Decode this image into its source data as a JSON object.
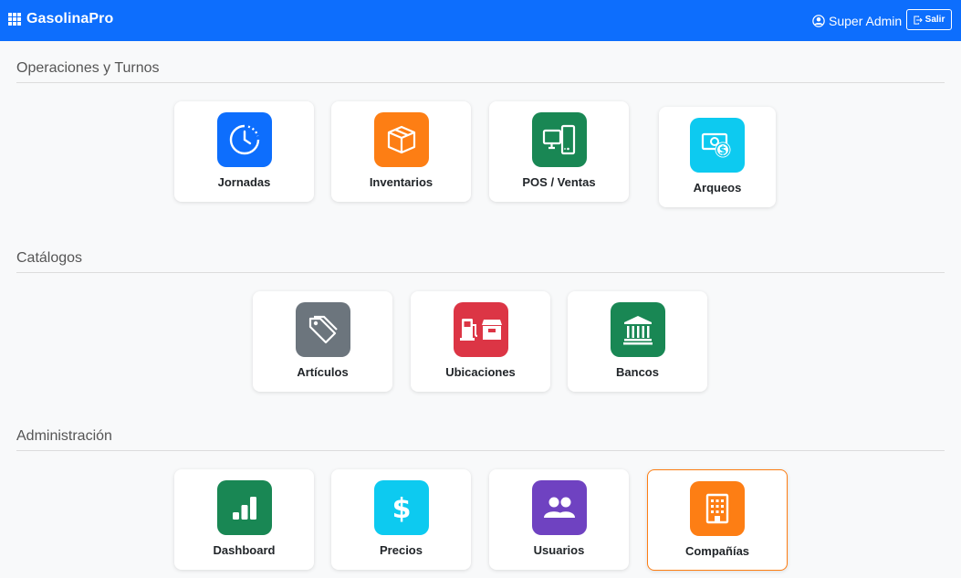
{
  "navbar": {
    "brand": "GasolinaPro",
    "user_label": "Super Admin",
    "logout_label": "Salir"
  },
  "colors": {
    "primary": "#0d6efd",
    "orange": "#fd7e14",
    "green": "#198754",
    "cyan": "#0dcaf0",
    "gray": "#6c757d",
    "red": "#dc3545",
    "purple": "#6f42c1"
  },
  "sections": [
    {
      "title": "Operaciones y Turnos",
      "cards": [
        {
          "label": "Jornadas",
          "icon": "clock-history-icon",
          "color": "#0d6efd"
        },
        {
          "label": "Inventarios",
          "icon": "box-icon",
          "color": "#fd7e14"
        },
        {
          "label": "POS / Ventas",
          "icon": "pos-devices-icon",
          "color": "#198754"
        },
        {
          "label": "Arqueos",
          "icon": "cash-coin-icon",
          "color": "#0dcaf0"
        }
      ]
    },
    {
      "title": "Catálogos",
      "cards": [
        {
          "label": "Artículos",
          "icon": "tags-icon",
          "color": "#6c757d"
        },
        {
          "label": "Ubicaciones",
          "icon": "fuel-pump-shop-icon",
          "color": "#dc3545"
        },
        {
          "label": "Bancos",
          "icon": "bank-icon",
          "color": "#198754"
        }
      ]
    },
    {
      "title": "Administración",
      "cards": [
        {
          "label": "Dashboard",
          "icon": "bar-chart-icon",
          "color": "#198754"
        },
        {
          "label": "Precios",
          "icon": "dollar-icon",
          "color": "#0dcaf0"
        },
        {
          "label": "Usuarios",
          "icon": "people-icon",
          "color": "#6f42c1"
        },
        {
          "label": "Compañías",
          "icon": "building-icon",
          "color": "#fd7e14"
        }
      ]
    }
  ]
}
